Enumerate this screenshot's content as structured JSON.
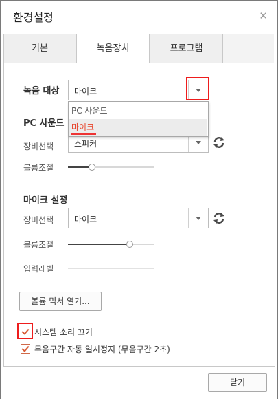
{
  "window": {
    "title": "환경설정",
    "close_icon": "close-icon"
  },
  "tabs": [
    {
      "label": "기본",
      "active": false
    },
    {
      "label": "녹음장치",
      "active": true
    },
    {
      "label": "프로그램",
      "active": false
    }
  ],
  "record_target": {
    "label": "녹음 대상",
    "value": "마이크",
    "options": [
      "PC 사운드",
      "마이크"
    ],
    "selected_option": "마이크"
  },
  "pc_sound": {
    "heading": "PC 사운드",
    "device_label": "장비선택",
    "device_value": "스피커",
    "volume_label": "볼륨조절",
    "volume_level": 0.28
  },
  "mic": {
    "heading": "마이크 설정",
    "device_label": "장비선택",
    "device_value": "마이크",
    "volume_label": "볼륨조절",
    "volume_level": 0.72,
    "input_level_label": "입력레벨",
    "input_level": 0.0
  },
  "buttons": {
    "open_mixer": "볼륨 믹서 열기...",
    "close": "닫기"
  },
  "checkboxes": [
    {
      "label": "시스템 소리 끄기",
      "checked": true
    },
    {
      "label": "무음구간 자동 일시정지 (무음구간 2초)",
      "checked": true
    }
  ],
  "colors": {
    "highlight": "#ee1d1d",
    "accent": "#e8452c"
  }
}
